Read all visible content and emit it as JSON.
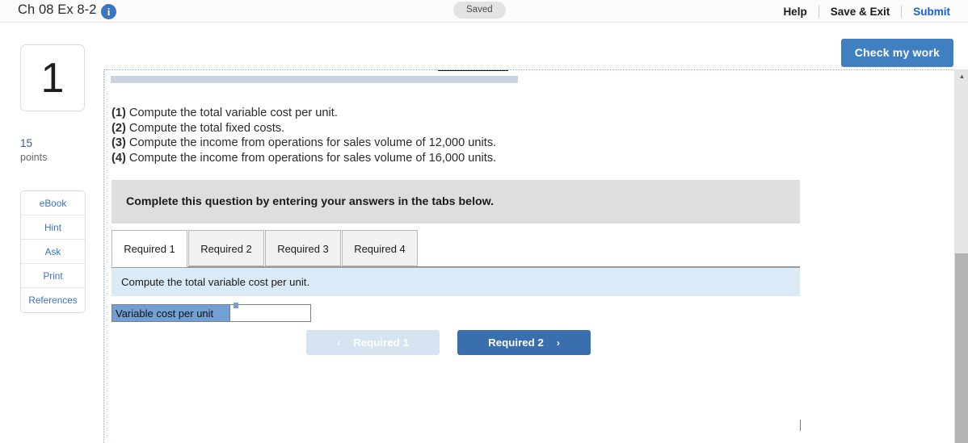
{
  "header": {
    "title": "Ch 08 Ex 8-2",
    "info_icon": "info-icon",
    "saved_label": "Saved",
    "links": [
      {
        "label": "Help",
        "accent": false
      },
      {
        "label": "Save & Exit",
        "accent": false
      },
      {
        "label": "Submit",
        "accent": true
      }
    ]
  },
  "rail": {
    "question_number": "1",
    "points_value": "15",
    "points_label": "points",
    "buttons": [
      {
        "label": "eBook"
      },
      {
        "label": "Hint"
      },
      {
        "label": "Ask"
      },
      {
        "label": "Print"
      },
      {
        "label": "References"
      }
    ]
  },
  "toolbar": {
    "check_my_work": "Check my work"
  },
  "question": {
    "items": [
      {
        "num": "(1)",
        "text": "Compute the total variable cost per unit."
      },
      {
        "num": "(2)",
        "text": "Compute the total fixed costs."
      },
      {
        "num": "(3)",
        "text": "Compute the income from operations for sales volume of 12,000 units."
      },
      {
        "num": "(4)",
        "text": "Compute the income from operations for sales volume of 16,000 units."
      }
    ],
    "complete_instruction": "Complete this question by entering your answers in the tabs below."
  },
  "tabs": [
    {
      "label": "Required 1",
      "active": true
    },
    {
      "label": "Required 2",
      "active": false
    },
    {
      "label": "Required 3",
      "active": false
    },
    {
      "label": "Required 4",
      "active": false
    }
  ],
  "answer_panel": {
    "prompt": "Compute the total variable cost per unit.",
    "row_label": "Variable cost per unit",
    "input_value": "",
    "input_placeholder": ""
  },
  "nav": {
    "prev_label": "Required 1",
    "prev_chevron": "‹",
    "next_label": "Required 2",
    "next_chevron": "›"
  },
  "scrollbar": {
    "up_arrow": "▲"
  },
  "colors": {
    "accent_blue": "#4180c0",
    "link_blue": "#1a62c9",
    "prompt_blue": "#daeaf7",
    "label_blue": "#72a0d4",
    "gray_box": "#dededc"
  }
}
